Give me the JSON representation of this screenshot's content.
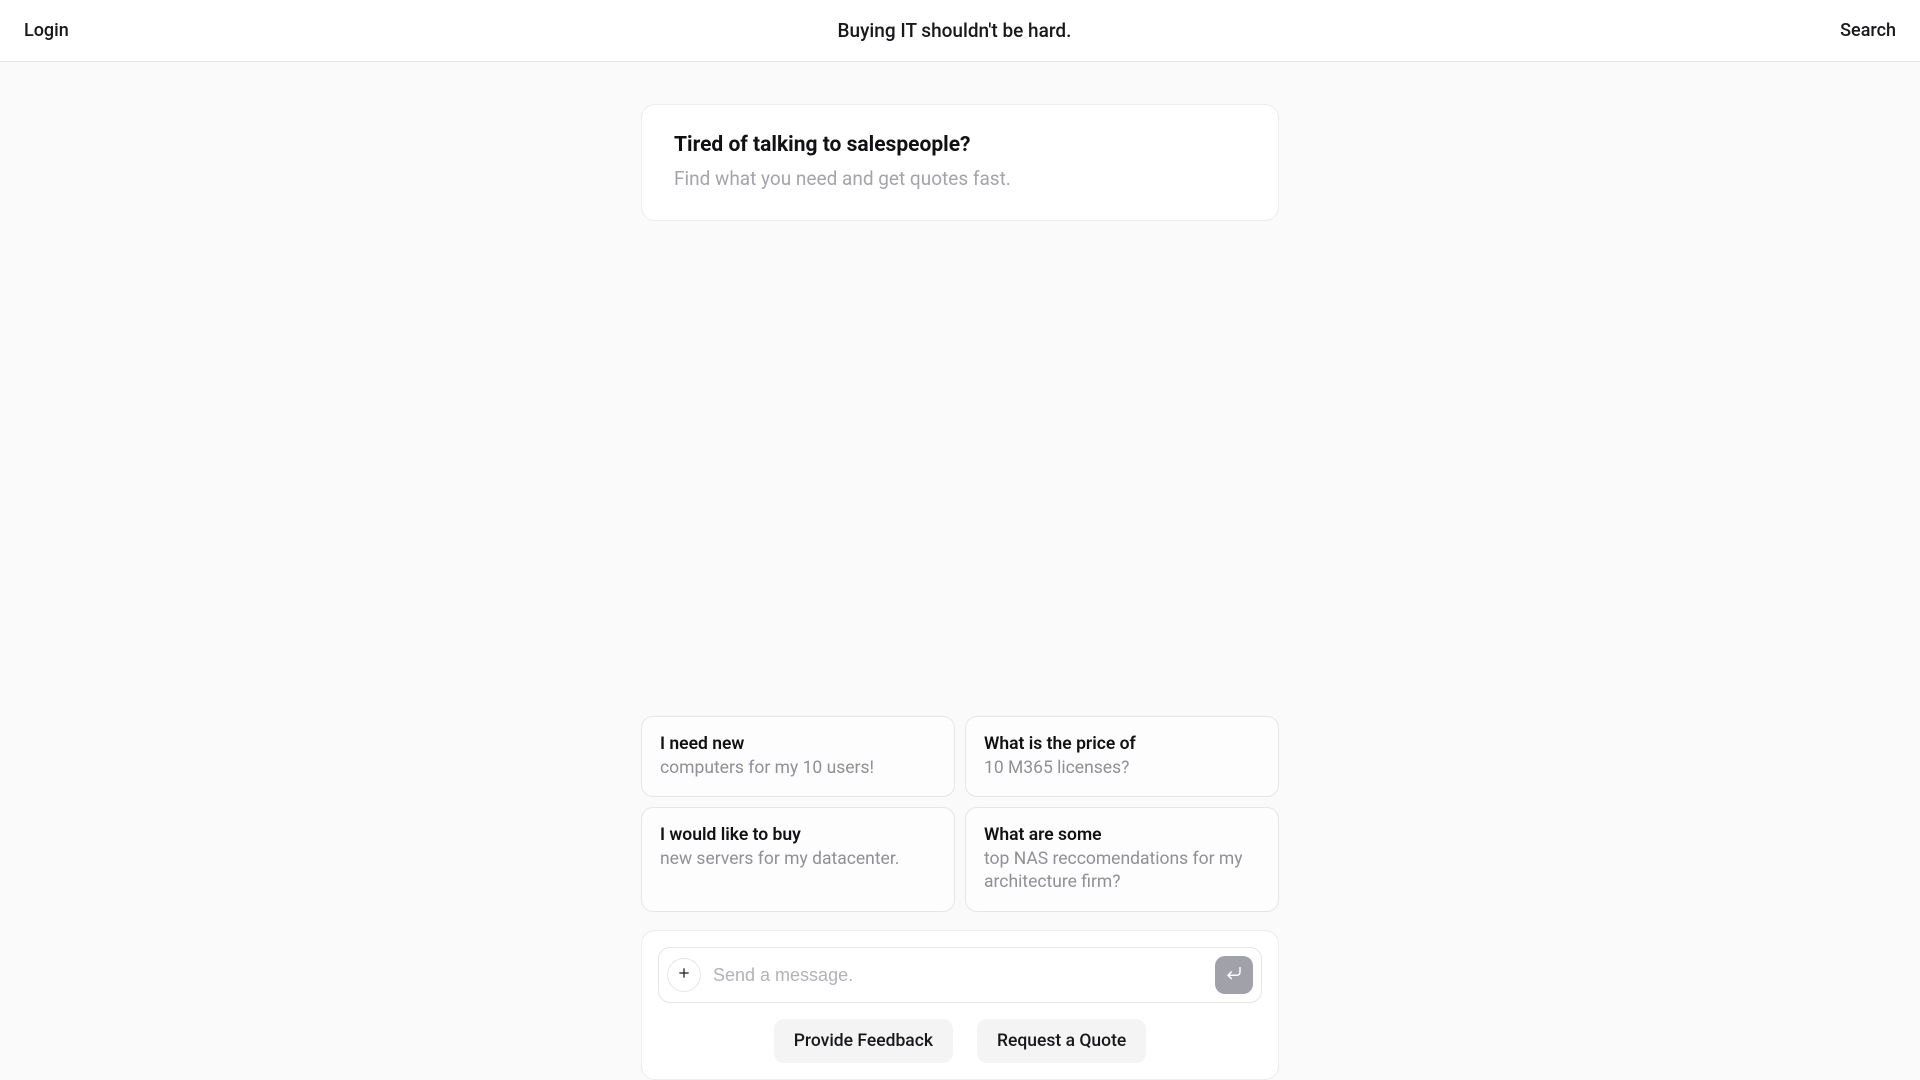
{
  "header": {
    "login_label": "Login",
    "title": "Buying IT shouldn't be hard.",
    "search_label": "Search"
  },
  "intro": {
    "heading": "Tired of talking to salespeople?",
    "sub": "Find what you need and get quotes fast."
  },
  "suggestions": [
    {
      "title": "I need new",
      "sub": "computers for my 10 users!"
    },
    {
      "title": "What is the price of",
      "sub": "10 M365 licenses?"
    },
    {
      "title": "I would like to buy",
      "sub": "new servers for my datacenter."
    },
    {
      "title": "What are some",
      "sub": "top NAS reccomendations for my architecture firm?"
    }
  ],
  "composer": {
    "placeholder": "Send a message.",
    "value": "",
    "plus_icon": "plus-icon",
    "send_icon": "enter-icon"
  },
  "actions": {
    "feedback_label": "Provide Feedback",
    "quote_label": "Request a Quote"
  },
  "colors": {
    "bg": "#fafafa",
    "card_bg": "#ffffff",
    "border": "#e6e6e7",
    "text_primary": "#18181b",
    "text_muted": "#a4a4aa",
    "send_btn_bg": "#a1a1aa",
    "action_bg": "#f4f4f5"
  }
}
